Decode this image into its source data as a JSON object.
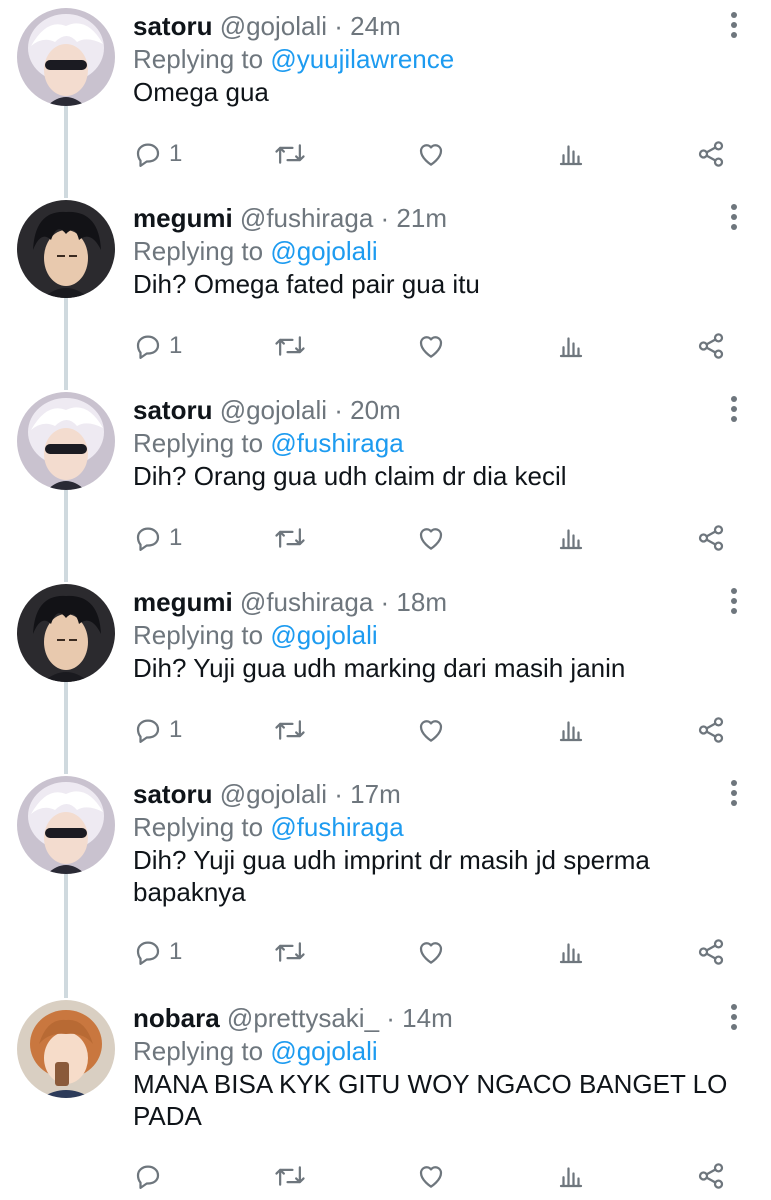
{
  "colors": {
    "link": "#1d9bf0",
    "muted": "#6e767d",
    "text": "#0f1419",
    "thread_line": "#cfd9de"
  },
  "tweets": [
    {
      "name": "satoru",
      "handle": "@gojolali",
      "time": "· 24m",
      "reply_prefix": "Replying to ",
      "reply_to": "@yuujilawrence",
      "text": "Omega gua",
      "reply_count": "1",
      "avatar": "satoru-avatar"
    },
    {
      "name": "megumi",
      "handle": "@fushiraga",
      "time": "· 21m",
      "reply_prefix": "Replying to ",
      "reply_to": "@gojolali",
      "text": "Dih? Omega fated pair gua itu",
      "reply_count": "1",
      "avatar": "megumi-avatar"
    },
    {
      "name": "satoru",
      "handle": "@gojolali",
      "time": "· 20m",
      "reply_prefix": "Replying to ",
      "reply_to": "@fushiraga",
      "text": "Dih? Orang gua udh claim dr dia kecil",
      "reply_count": "1",
      "avatar": "satoru-avatar"
    },
    {
      "name": "megumi",
      "handle": "@fushiraga",
      "time": "· 18m",
      "reply_prefix": "Replying to ",
      "reply_to": "@gojolali",
      "text": "Dih? Yuji gua udh marking dari masih janin",
      "reply_count": "1",
      "avatar": "megumi-avatar"
    },
    {
      "name": "satoru",
      "handle": "@gojolali",
      "time": "· 17m",
      "reply_prefix": "Replying to ",
      "reply_to": "@fushiraga",
      "text": "Dih? Yuji gua udh imprint dr masih jd sperma bapaknya",
      "reply_count": "1",
      "avatar": "satoru-avatar"
    },
    {
      "name": "nobara",
      "handle": "@prettysaki_",
      "time": "· 14m",
      "reply_prefix": "Replying to ",
      "reply_to": "@gojolali",
      "text": "MANA BISA KYK GITU WOY NGACO BANGET LO PADA",
      "reply_count": "",
      "avatar": "nobara-avatar"
    }
  ],
  "icons": {
    "reply": "reply-icon",
    "retweet": "retweet-icon",
    "like": "like-icon",
    "views": "views-icon",
    "share": "share-icon",
    "more": "more-icon"
  }
}
